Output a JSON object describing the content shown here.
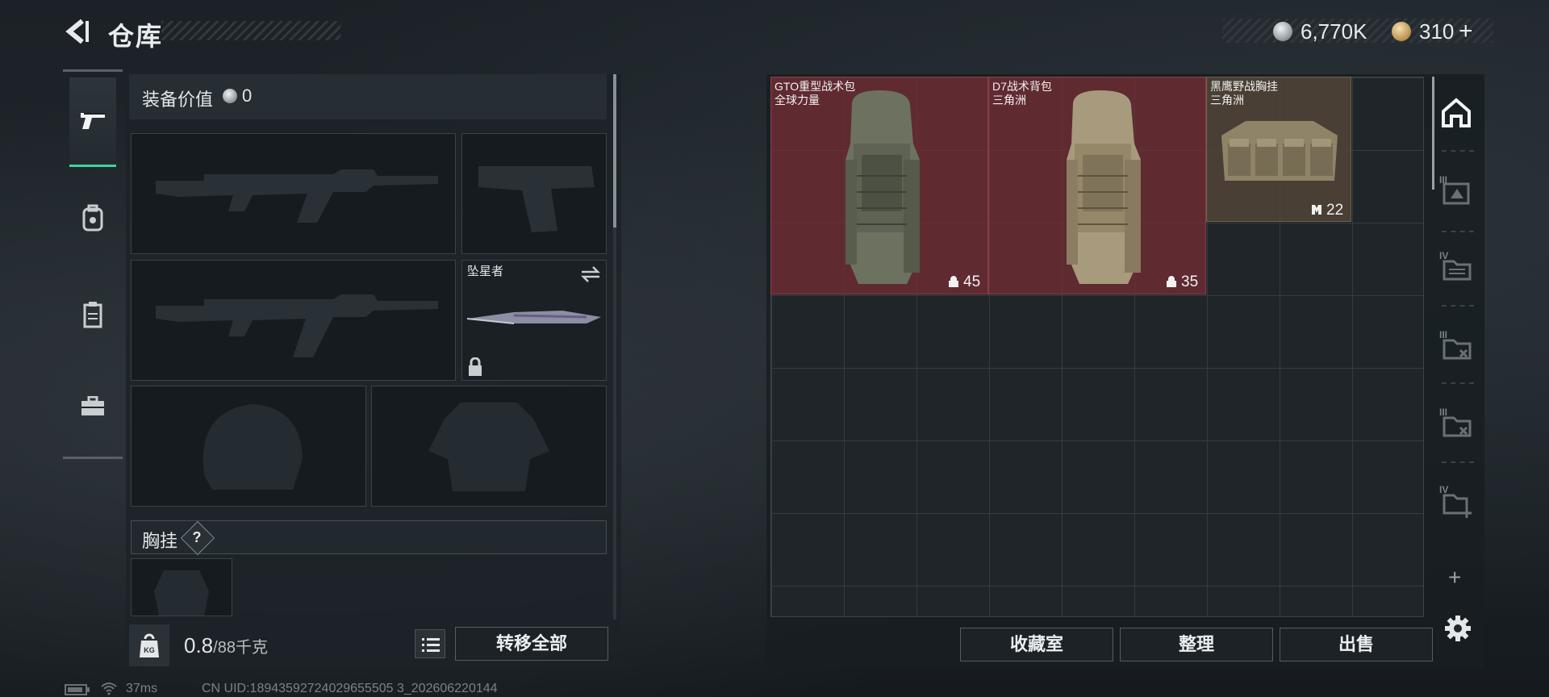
{
  "header": {
    "title": "仓库"
  },
  "currencies": [
    {
      "icon": "silver-coin-icon",
      "value": "6,770K"
    },
    {
      "icon": "gold-coin-icon",
      "value": "310",
      "suffix": "+"
    }
  ],
  "nav": [
    {
      "name": "weapons",
      "icon": "pistol-icon",
      "active": true
    },
    {
      "name": "backpack",
      "icon": "backpack-icon",
      "active": false
    },
    {
      "name": "armor",
      "icon": "vest-icon",
      "active": false
    },
    {
      "name": "toolbox",
      "icon": "briefcase-icon",
      "active": false
    }
  ],
  "loadout": {
    "value_label": "装备价值",
    "value": "0",
    "melee_name": "坠星者",
    "chest_rig_label": "胸挂",
    "chest_rig_help": "?"
  },
  "footer_left": {
    "weight_value": "0.8",
    "weight_capacity": "/88千克",
    "transfer_all": "转移全部"
  },
  "storage": {
    "items": [
      {
        "name": "GTO重型战术包",
        "brand": "全球力量",
        "count": "45",
        "rarity_color": "#7a2c34"
      },
      {
        "name": "D7战术背包",
        "brand": "三角洲",
        "count": "35",
        "rarity_color": "#7a2c34"
      },
      {
        "name": "黑鹰野战胸挂",
        "brand": "三角洲",
        "count": "22",
        "rarity_color": "#54463a"
      }
    ],
    "side_tabs": [
      {
        "icon": "home-tab-icon",
        "active": true
      },
      {
        "icon": "tier-3-tab-icon",
        "label": "III"
      },
      {
        "icon": "tier-4-tab-icon",
        "label": "IV"
      },
      {
        "icon": "tier-3-tab-icon",
        "label": "III"
      },
      {
        "icon": "tier-3-tab-icon",
        "label": "III"
      },
      {
        "icon": "tier-4-add-tab-icon",
        "label": "IV"
      }
    ],
    "add": "+",
    "buttons": {
      "collection": "收藏室",
      "organize": "整理",
      "sell": "出售"
    }
  },
  "status_bar": {
    "ping": "37ms",
    "uid": "CN UID:18943592724029655505 3_202606220144"
  }
}
